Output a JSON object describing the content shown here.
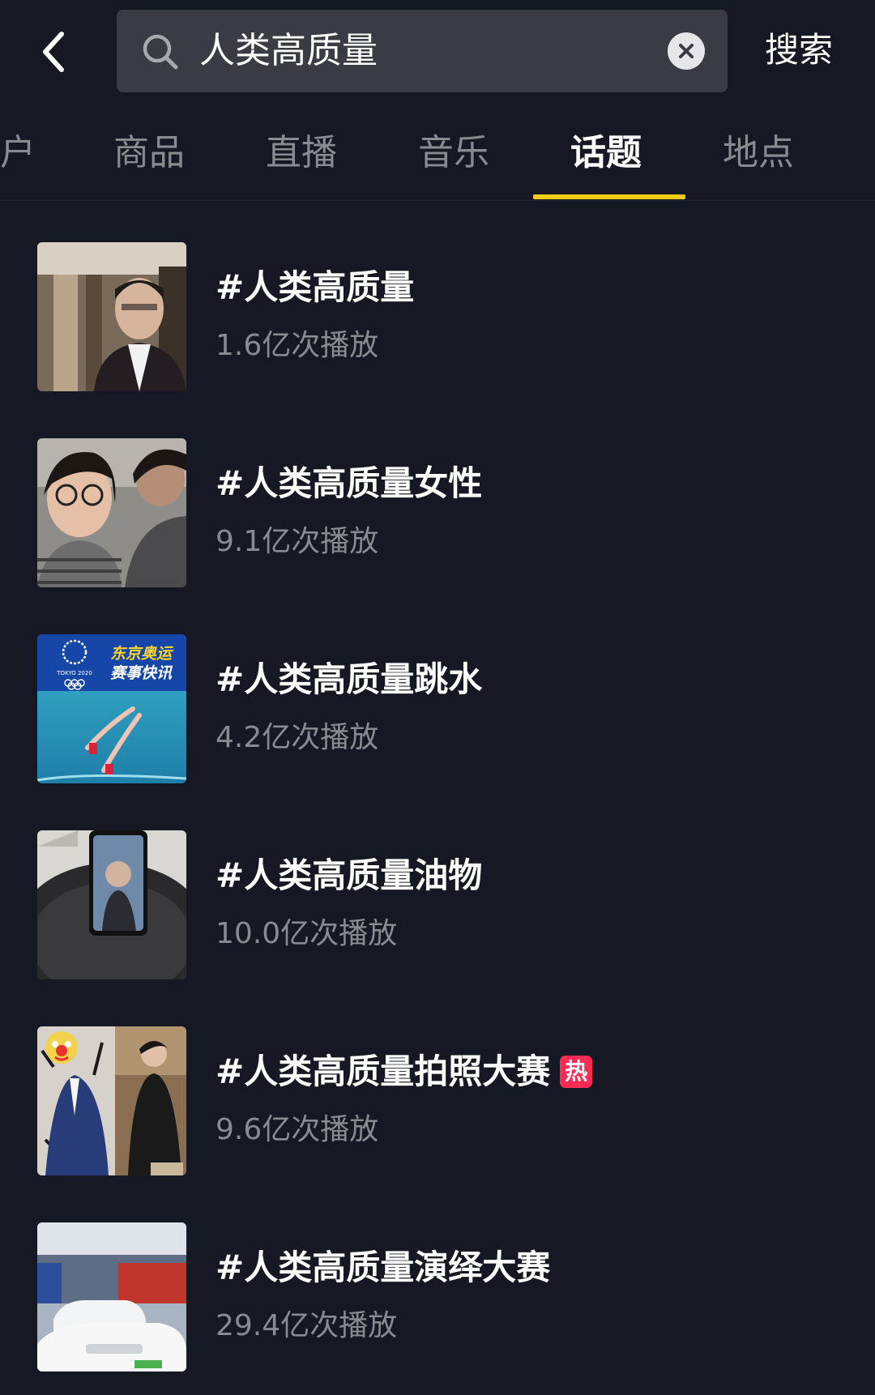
{
  "search": {
    "query": "人类高质量",
    "submit_label": "搜索"
  },
  "tabs": [
    {
      "label": "户",
      "active": false
    },
    {
      "label": "商品",
      "active": false
    },
    {
      "label": "直播",
      "active": false
    },
    {
      "label": "音乐",
      "active": false
    },
    {
      "label": "话题",
      "active": true
    },
    {
      "label": "地点",
      "active": false
    }
  ],
  "colors": {
    "background": "#161823",
    "accent": "#face15",
    "hot": "#fe2c55",
    "muted_text": "#8a8b91"
  },
  "topics": [
    {
      "title": "#人类高质量",
      "views": "1.6亿次播放",
      "thumbnail": "man-in-suit-indoors"
    },
    {
      "title": "#人类高质量女性",
      "views": "9.1亿次播放",
      "thumbnail": "couple-selfie-in-car"
    },
    {
      "title": "#人类高质量跳水",
      "views": "4.2亿次播放",
      "thumbnail": "olympic-diving",
      "thumb_caption_1": "东京奥运",
      "thumb_caption_2": "赛事快讯",
      "thumb_logo_text": "TOKYO 2020"
    },
    {
      "title": "#人类高质量油物",
      "views": "10.0亿次播放",
      "thumbnail": "phone-in-frying-pan"
    },
    {
      "title": "#人类高质量拍照大赛",
      "views": "9.6亿次播放",
      "thumbnail": "mirror-selfies",
      "badge": "热"
    },
    {
      "title": "#人类高质量演绎大赛",
      "views": "29.4亿次播放",
      "thumbnail": "car-showroom"
    }
  ]
}
